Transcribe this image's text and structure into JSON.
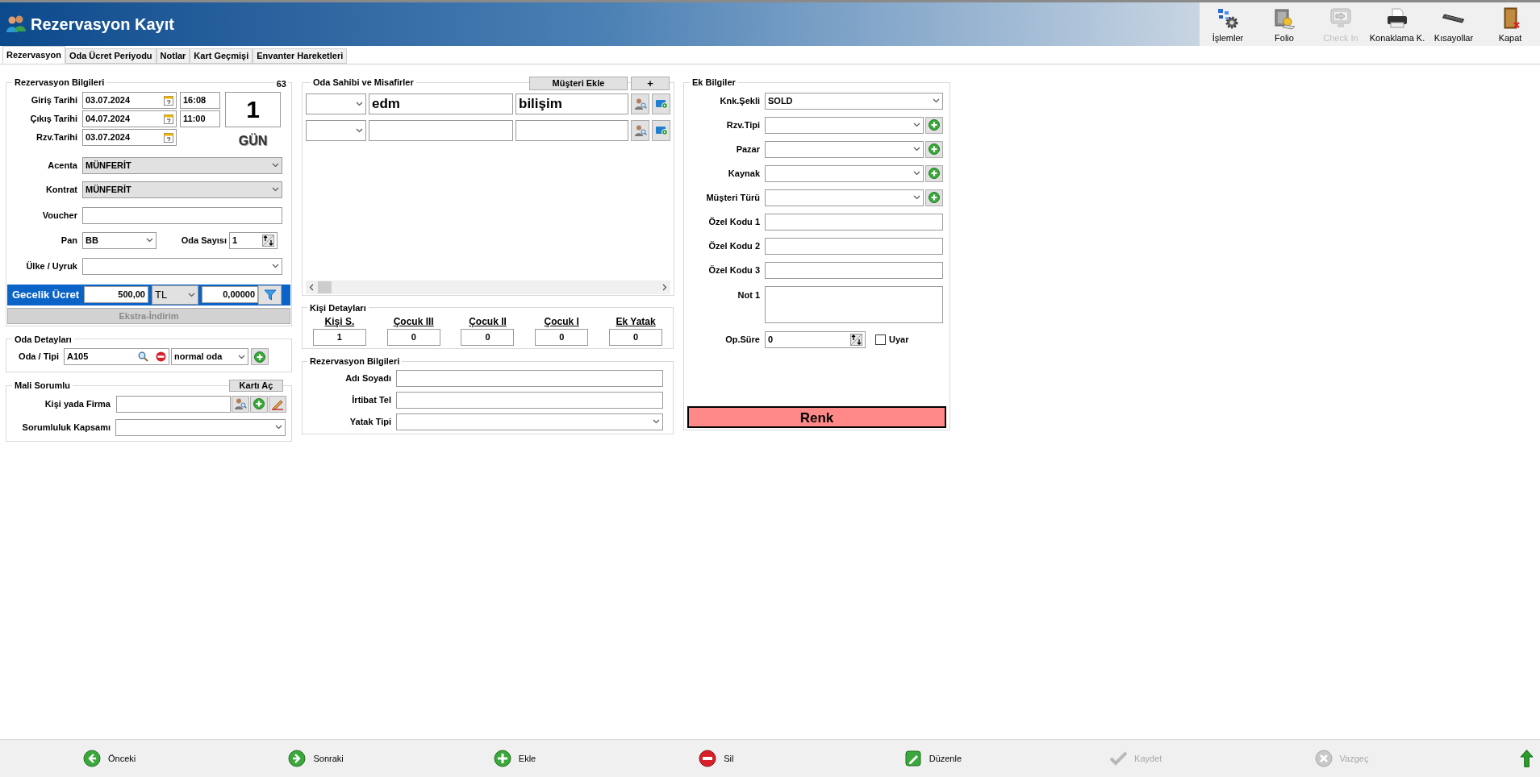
{
  "window": {
    "title": "Rezervasyon Kayıt"
  },
  "toolbar": [
    {
      "label": "İşlemler",
      "kind": "gear",
      "disabled": false
    },
    {
      "label": "Folio",
      "kind": "safe",
      "disabled": false
    },
    {
      "label": "Check In",
      "kind": "monitor",
      "disabled": true
    },
    {
      "label": "Konaklama K.",
      "kind": "printer",
      "disabled": false
    },
    {
      "label": "Kısayollar",
      "kind": "keyboard",
      "disabled": false
    },
    {
      "label": "Kapat",
      "kind": "door",
      "disabled": false
    }
  ],
  "tabs": [
    {
      "label": "Rezervasyon",
      "selected": true
    },
    {
      "label": "Oda Ücret Periyodu",
      "selected": false
    },
    {
      "label": "Notlar",
      "selected": false
    },
    {
      "label": "Kart Geçmişi",
      "selected": false
    },
    {
      "label": "Envanter Hareketleri",
      "selected": false
    }
  ],
  "reservation_info": {
    "title": "Rezervasyon Bilgileri",
    "count": "63",
    "checkin": {
      "label": "Giriş Tarihi",
      "date": "03.07.2024",
      "time": "16:08"
    },
    "checkout": {
      "label": "Çıkış Tarihi",
      "date": "04.07.2024",
      "time": "11:00"
    },
    "booking_date": {
      "label": "Rzv.Tarihi",
      "date": "03.07.2024"
    },
    "nights": {
      "value": "1",
      "unit": "GÜN"
    },
    "agency": {
      "label": "Acenta",
      "value": "MÜNFERİT"
    },
    "contract": {
      "label": "Kontrat",
      "value": "MÜNFERİT"
    },
    "voucher": {
      "label": "Voucher"
    },
    "board": {
      "label": "Pan",
      "value": "BB"
    },
    "room_count": {
      "label": "Oda Sayısı",
      "value": "1"
    },
    "country": {
      "label": "Ülke / Uyruk"
    },
    "nightly_rate": {
      "label": "Gecelik Ücret",
      "amount": "500,00",
      "currency": "TL",
      "rate": "0,00000"
    },
    "extra_discount": {
      "label": "Ekstra-İndirim",
      "disabled": true
    }
  },
  "room_details": {
    "title": "Oda Detayları",
    "label": "Oda / Tipi",
    "room": "A105",
    "room_type": "normal oda"
  },
  "financial": {
    "title": "Mali Sorumlu",
    "open_card_button": "Kartı Aç",
    "person_label": "Kişi yada Firma",
    "scope_label": "Sorumluluk Kapsamı"
  },
  "guests": {
    "title": "Oda Sahibi ve Misafirler",
    "add_button": "Müşteri Ekle",
    "plus_button": "+",
    "rows": [
      {
        "first_name": "edm",
        "last_name": "bilişim"
      },
      {}
    ]
  },
  "person_details": {
    "title": "Kişi Detayları",
    "columns": [
      {
        "label": "Kişi S.",
        "value": "1"
      },
      {
        "label": "Çocuk III",
        "value": "0"
      },
      {
        "label": "Çocuk II",
        "value": "0"
      },
      {
        "label": "Çocuk I",
        "value": "0"
      },
      {
        "label": "Ek Yatak",
        "value": "0"
      }
    ]
  },
  "contact": {
    "title": "Rezervasyon Bilgileri",
    "fields": [
      {
        "label": "Adı Soyadı",
        "kind": "text"
      },
      {
        "label": "İrtibat Tel",
        "kind": "text"
      },
      {
        "label": "Yatak Tipi",
        "kind": "select"
      }
    ]
  },
  "extra_info": {
    "title": "Ek Bilgiler",
    "fields": [
      {
        "label": "Knk.Şekli",
        "kind": "select",
        "value": "SOLD"
      },
      {
        "label": "Rzv.Tipi",
        "kind": "select_add"
      },
      {
        "label": "Pazar",
        "kind": "select_add"
      },
      {
        "label": "Kaynak",
        "kind": "select_add"
      },
      {
        "label": "Müşteri Türü",
        "kind": "select_add"
      },
      {
        "label": "Özel Kodu 1",
        "kind": "text"
      },
      {
        "label": "Özel Kodu 2",
        "kind": "text"
      },
      {
        "label": "Özel Kodu 3",
        "kind": "text"
      },
      {
        "label": "Not 1",
        "kind": "textarea"
      }
    ],
    "option_period": {
      "label": "Op.Süre",
      "value": "0"
    },
    "warn": {
      "label": "Uyar",
      "checked": false
    },
    "color_button": "Renk"
  },
  "bottom_bar": [
    {
      "label": "Önceki",
      "kind": "prev",
      "disabled": false
    },
    {
      "label": "Sonraki",
      "kind": "next",
      "disabled": false
    },
    {
      "label": "Ekle",
      "kind": "add",
      "disabled": false
    },
    {
      "label": "Sil",
      "kind": "delete",
      "disabled": false
    },
    {
      "label": "Düzenle",
      "kind": "edit",
      "disabled": false
    },
    {
      "label": "Kaydet",
      "kind": "save",
      "disabled": true
    },
    {
      "label": "Vazgeç",
      "kind": "cancel",
      "disabled": true
    }
  ]
}
